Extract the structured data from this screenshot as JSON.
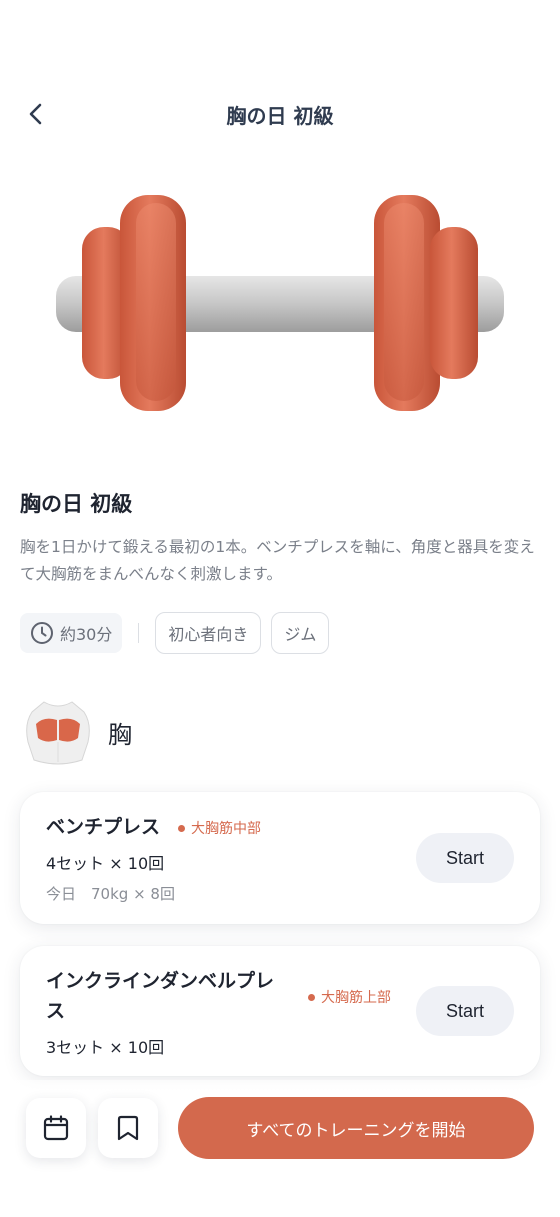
{
  "header": {
    "title": "胸の日 初級",
    "back_icon": "chevron-left-icon"
  },
  "hero": {
    "icon": "dumbbell-illustration",
    "plate_color": "#d9674a",
    "bar_color": "#c9c9c9"
  },
  "intro": {
    "title": "胸の日 初級",
    "description": "胸を1日かけて鍛える最初の1本。ベンチプレスを軸に、角度と器具を変えて大胸筋をまんべんなく刺激します。"
  },
  "tags": {
    "duration": "約30分",
    "level": "初心者向き",
    "place": "ジム"
  },
  "muscle_group": {
    "label": "胸",
    "icon": "chest-torso-icon"
  },
  "exercises": [
    {
      "name": "ベンチプレス",
      "target": "大胸筋中部",
      "sets": "4セット × 10回",
      "today": "今日　70kg × 8回",
      "start_label": "Start"
    },
    {
      "name_line1": "インクラインダンベルプレ",
      "name_line2": "ス",
      "target": "大胸筋上部",
      "sets": "3セット × 10回",
      "start_label": "Start"
    }
  ],
  "bottom": {
    "calendar_icon": "calendar-icon",
    "bookmark_icon": "bookmark-icon",
    "cta_label": "すべてのトレーニングを開始"
  },
  "colors": {
    "accent": "#d3694d",
    "title": "#2f3b4f"
  }
}
